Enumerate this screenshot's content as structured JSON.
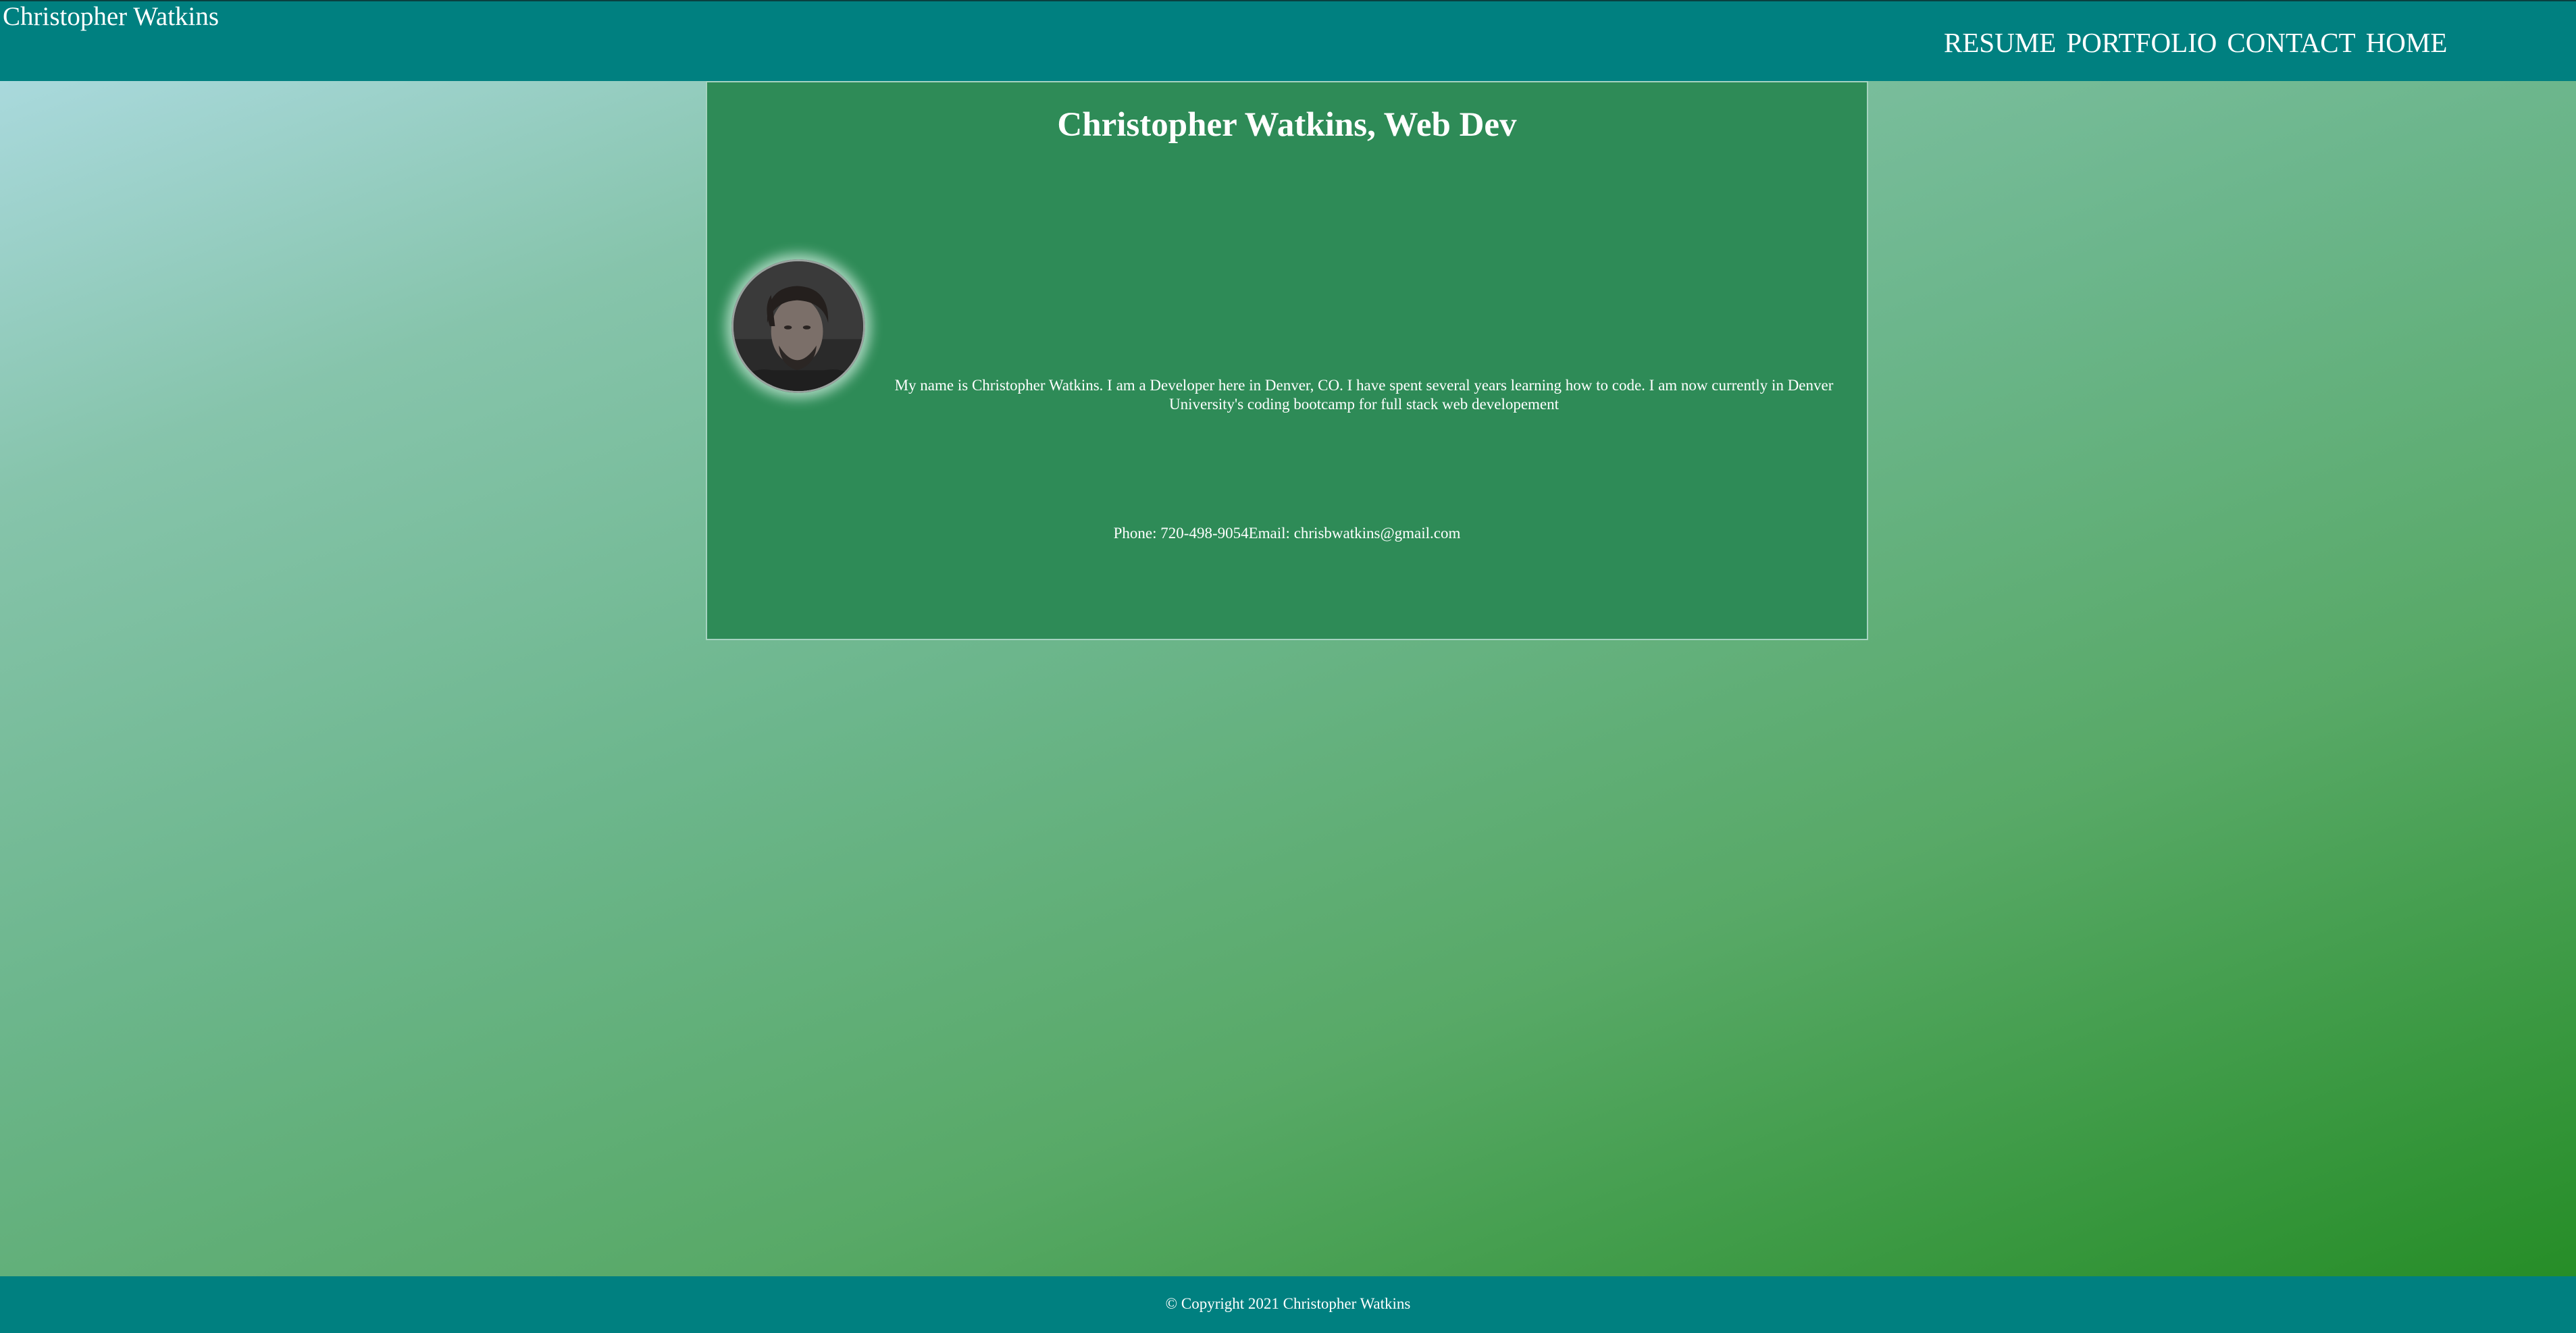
{
  "header": {
    "brand": "Christopher Watkins",
    "nav": [
      {
        "label": "RESUME"
      },
      {
        "label": "PORTFOLIO"
      },
      {
        "label": "CONTACT"
      },
      {
        "label": "HOME"
      }
    ]
  },
  "card": {
    "title": "Christopher Watkins, Web Dev",
    "bio": "My name is Christopher Watkins. I am a Developer here in Denver, CO. I have spent several years learning how to code. I am now currently in Denver University's coding bootcamp for full stack web developement",
    "phone_label": "Phone: ",
    "phone": "720-498-9054",
    "email_label": "Email: ",
    "email": "chrisbwatkins@gmail.com",
    "avatar_alt": "Christopher Watkins"
  },
  "footer": {
    "copyright": "© Copyright 2021 Christopher Watkins"
  },
  "colors": {
    "header_bg": "#008080",
    "card_bg": "#2e8b57",
    "text": "#ffffff"
  },
  "icons": {
    "avatar": "profile-photo"
  }
}
